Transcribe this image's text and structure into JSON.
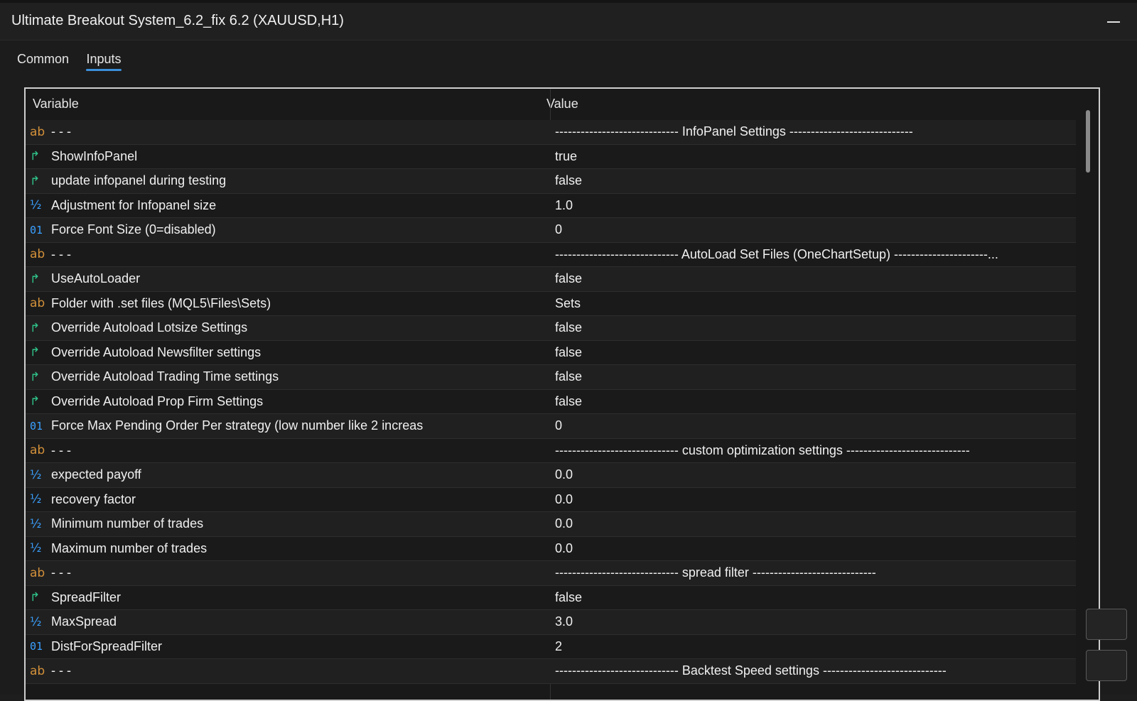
{
  "window": {
    "title": "Ultimate Breakout System_6.2_fix 6.2 (XAUUSD,H1)"
  },
  "tabs": [
    {
      "label": "Common"
    },
    {
      "label": "Inputs"
    }
  ],
  "table": {
    "headers": {
      "variable": "Variable",
      "value": "Value"
    },
    "rows": [
      {
        "icon": "ab",
        "variable": "- - -",
        "value": "----------------------------- InfoPanel Settings  -----------------------------"
      },
      {
        "icon": "bool",
        "variable": "ShowInfoPanel",
        "value": "true"
      },
      {
        "icon": "bool",
        "variable": "update infopanel during testing",
        "value": "false"
      },
      {
        "icon": "num",
        "variable": "Adjustment for Infopanel size",
        "value": "1.0"
      },
      {
        "icon": "int",
        "variable": "Force Font Size (0=disabled)",
        "value": "0"
      },
      {
        "icon": "ab",
        "variable": "- - -",
        "value": "----------------------------- AutoLoad Set Files (OneChartSetup)  ----------------------..."
      },
      {
        "icon": "bool",
        "variable": "UseAutoLoader",
        "value": "false"
      },
      {
        "icon": "ab",
        "variable": "Folder with .set files (MQL5\\Files\\Sets)",
        "value": "Sets"
      },
      {
        "icon": "bool",
        "variable": "Override Autoload Lotsize Settings",
        "value": "false"
      },
      {
        "icon": "bool",
        "variable": "Override Autoload Newsfilter settings",
        "value": "false"
      },
      {
        "icon": "bool",
        "variable": "Override Autoload Trading Time settings",
        "value": "false"
      },
      {
        "icon": "bool",
        "variable": "Override Autoload Prop Firm Settings",
        "value": "false"
      },
      {
        "icon": "int",
        "variable": "Force Max Pending Order Per strategy (low number like 2 increas",
        "value": "0"
      },
      {
        "icon": "ab",
        "variable": "- - -",
        "value": "----------------------------- custom optimization settings -----------------------------"
      },
      {
        "icon": "num",
        "variable": "expected payoff",
        "value": "0.0"
      },
      {
        "icon": "num",
        "variable": "recovery factor",
        "value": "0.0"
      },
      {
        "icon": "num",
        "variable": "Minimum number of trades",
        "value": "0.0"
      },
      {
        "icon": "num",
        "variable": "Maximum number of trades",
        "value": "0.0"
      },
      {
        "icon": "ab",
        "variable": "- - -",
        "value": "----------------------------- spread filter -----------------------------"
      },
      {
        "icon": "bool",
        "variable": "SpreadFilter",
        "value": "false"
      },
      {
        "icon": "num",
        "variable": "MaxSpread",
        "value": "3.0"
      },
      {
        "icon": "int",
        "variable": "DistForSpreadFilter",
        "value": "2"
      },
      {
        "icon": "ab",
        "variable": "- - -",
        "value": "----------------------------- Backtest Speed settings -----------------------------"
      }
    ]
  },
  "icons": {
    "ab": {
      "glyph": "ab",
      "name": "string-type-icon"
    },
    "bool": {
      "glyph": "↱",
      "name": "bool-type-icon"
    },
    "num": {
      "glyph": "½",
      "name": "double-type-icon"
    },
    "int": {
      "glyph": "01",
      "name": "integer-type-icon"
    }
  },
  "colors": {
    "accent": "#3b8fd9",
    "string_icon": "#d4913a",
    "bool_icon": "#2fc48a",
    "number_icon": "#3aa0ff"
  }
}
